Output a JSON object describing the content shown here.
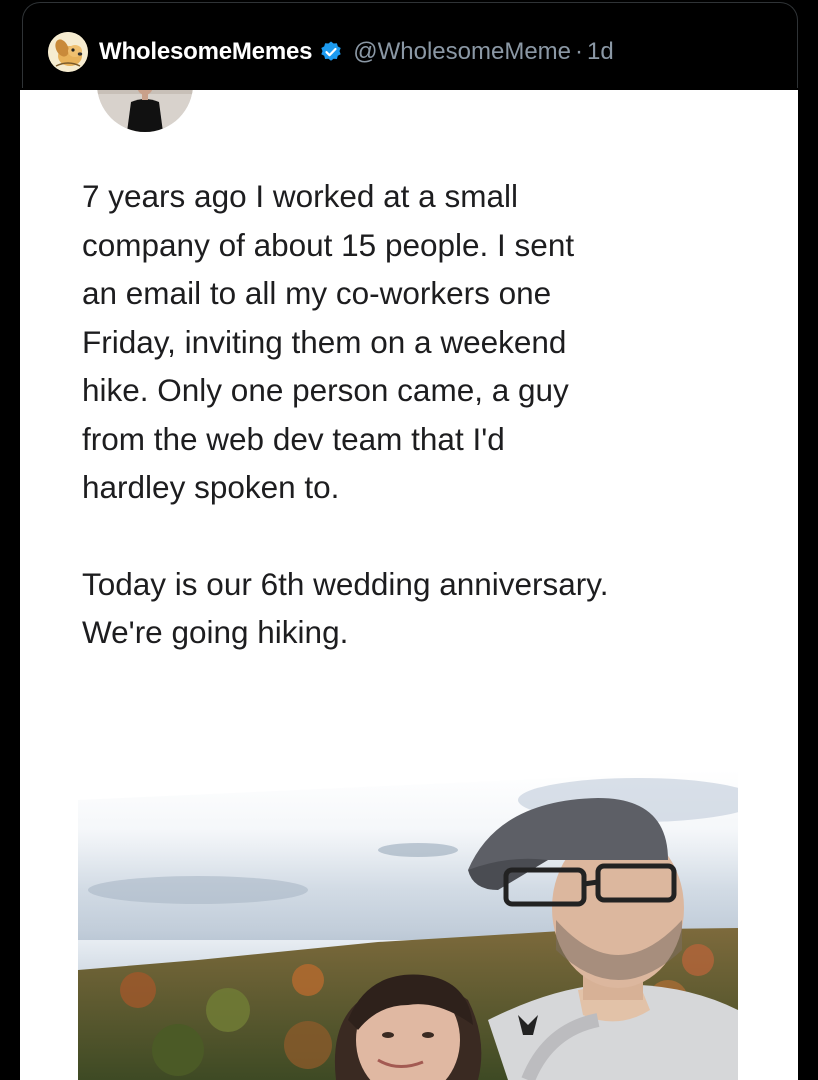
{
  "header": {
    "display_name": "WholesomeMemes",
    "handle": "@WholesomeMeme",
    "separator": "·",
    "timestamp": "1d"
  },
  "post": {
    "paragraph_1_lines": [
      "7 years ago I worked at a small",
      "company of about 15 people. I sent",
      "an email to all my co-workers one",
      "Friday, inviting them on a weekend",
      "hike. Only one person came, a guy",
      "from the web dev team that I'd",
      "hardley spoken to."
    ],
    "paragraph_2_lines": [
      "Today is our 6th wedding anniversary.",
      "We're going hiking."
    ]
  },
  "icons": {
    "account_avatar": "dog-avatar-icon",
    "verified": "verified-badge-icon"
  },
  "colors": {
    "background": "#000000",
    "card": "#ffffff",
    "verified_blue": "#1d9bf0",
    "handle_gray": "#8b98a5"
  }
}
